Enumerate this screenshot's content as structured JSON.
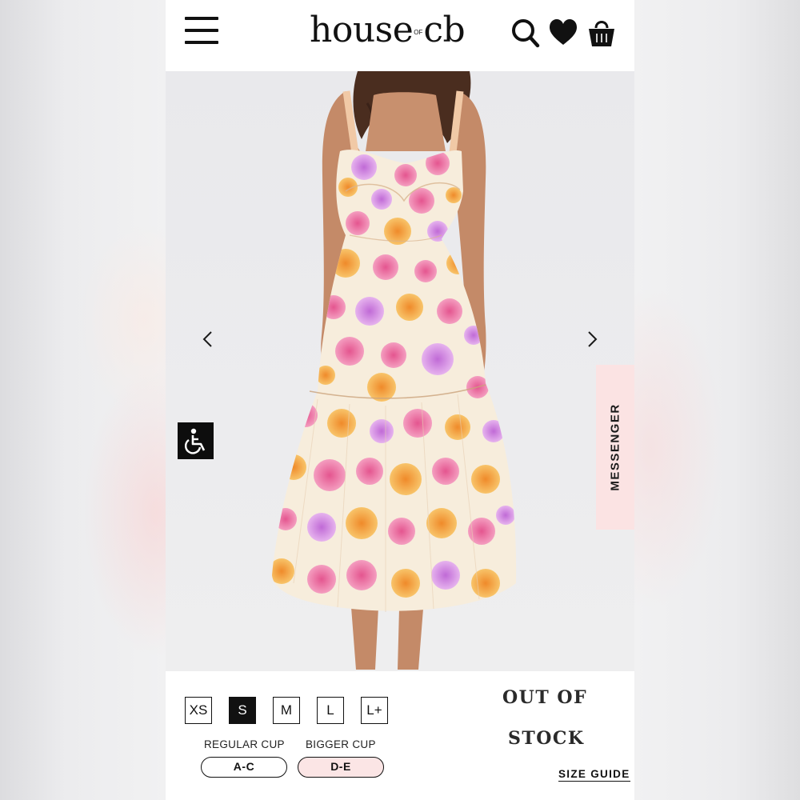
{
  "header": {
    "logo_left": "house",
    "logo_of": "OF",
    "logo_right": "cb",
    "icons": [
      "menu-icon",
      "search-icon",
      "heart-icon",
      "shopping-bag-icon"
    ]
  },
  "hero": {
    "image_alt": "Floral print midi dress",
    "prev_icon": "chevron-left-icon",
    "next_icon": "chevron-right-icon",
    "accessibility_icon": "wheelchair-icon",
    "messenger_label": "MESSENGER"
  },
  "sizes": {
    "options": [
      "XS",
      "S",
      "M",
      "L",
      "L+"
    ],
    "selected": "S"
  },
  "cups": {
    "regular_label": "REGULAR CUP",
    "regular_value": "A-C",
    "bigger_label": "BIGGER CUP",
    "bigger_value": "D-E"
  },
  "stock": {
    "line1": "OUT OF",
    "line2": "STOCK"
  },
  "size_guide_label": "SIZE GUIDE",
  "colors": {
    "brand": "#111111",
    "messenger_bg": "#fbe3e3",
    "bigger_cup_bg": "#fbe5e5"
  }
}
